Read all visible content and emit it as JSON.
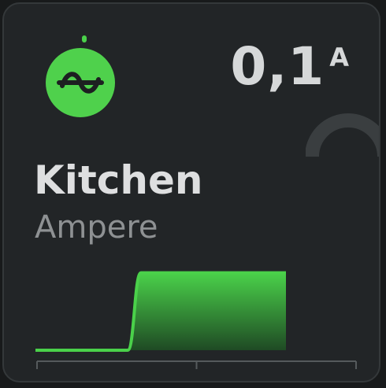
{
  "card": {
    "title": "Kitchen",
    "subtitle": "Ampere",
    "value": "0,1",
    "unit": "A",
    "icon": "sine-wave-icon"
  },
  "colors": {
    "background": "#222527",
    "accent": "#4ad14a",
    "icon_bg": "#4fd14c",
    "icon_fg": "#1d1f21",
    "gauge": "#3a3e40",
    "axis": "#555a5c",
    "text_primary": "#dedfe0",
    "text_secondary": "#8e9193"
  },
  "chart_data": {
    "type": "area",
    "title": "",
    "xlabel": "",
    "ylabel": "",
    "ylim": [
      0,
      0.12
    ],
    "x_range": [
      0,
      19
    ],
    "series": [
      {
        "values": [
          0,
          0,
          0,
          0,
          0,
          0,
          0,
          0,
          0.1,
          0.1,
          0.1,
          0.1,
          0.1,
          0.1,
          0.1,
          0.1,
          0.1,
          0.1,
          0.1,
          0.1
        ]
      }
    ],
    "x_tick_count": 3,
    "grid": false,
    "legend": "none"
  }
}
